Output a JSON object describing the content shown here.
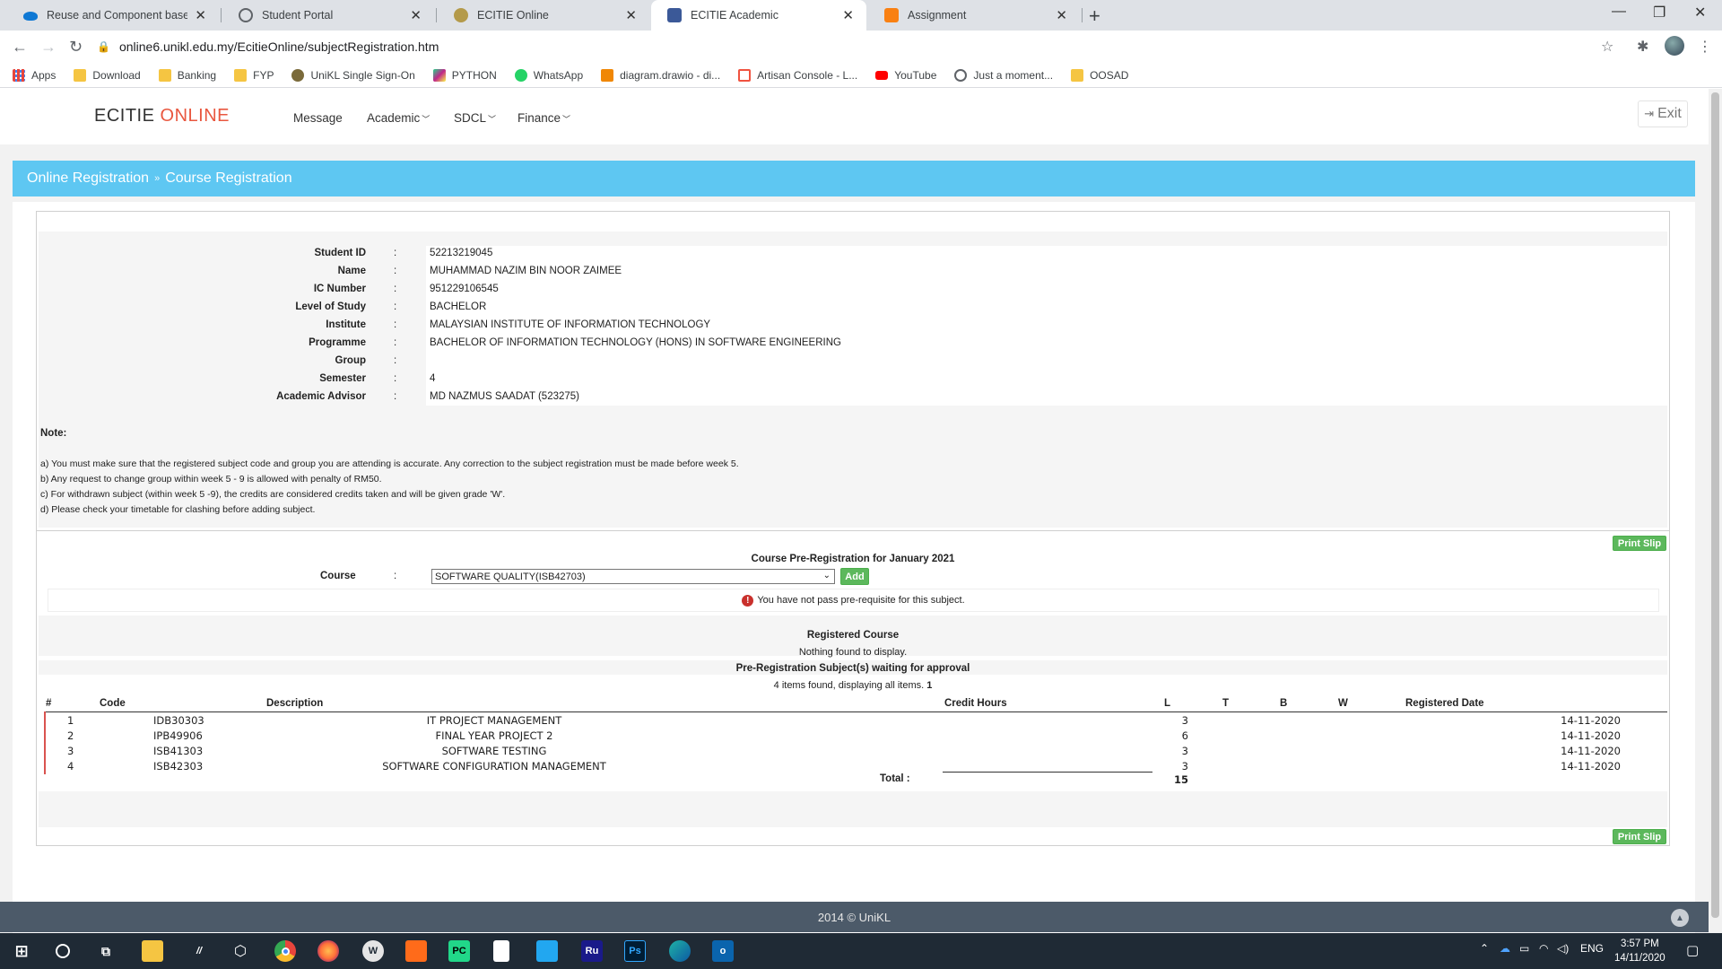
{
  "browser": {
    "tabs": [
      {
        "title": "Reuse and Component based De",
        "icon": "onedrive-icon"
      },
      {
        "title": "Student Portal",
        "icon": "globe-icon"
      },
      {
        "title": "ECITIE Online",
        "icon": "unikl-icon"
      },
      {
        "title": "ECITIE Academic",
        "icon": "ecitie-icon",
        "active": true
      },
      {
        "title": "Assignment",
        "icon": "moodle-icon"
      }
    ],
    "new_tab": "+",
    "url": "online6.unikl.edu.my/EcitieOnline/subjectRegistration.htm",
    "bookmarks": [
      {
        "label": "Apps",
        "icon": "apps-grid-icon",
        "color": "#e8453c"
      },
      {
        "label": "Download",
        "icon": "folder-icon",
        "color": "#f5c542"
      },
      {
        "label": "Banking",
        "icon": "folder-icon",
        "color": "#f5c542"
      },
      {
        "label": "FYP",
        "icon": "folder-icon",
        "color": "#f5c542"
      },
      {
        "label": "UniKL Single Sign-On",
        "icon": "unikl-icon",
        "color": "#7a6a3a"
      },
      {
        "label": "PYTHON",
        "icon": "pycharm-icon",
        "color": "#c0268a"
      },
      {
        "label": "WhatsApp",
        "icon": "whatsapp-icon",
        "color": "#25d366"
      },
      {
        "label": "diagram.drawio - di...",
        "icon": "drawio-icon",
        "color": "#f08705"
      },
      {
        "label": "Artisan Console - L...",
        "icon": "laravel-icon",
        "color": "#f05340"
      },
      {
        "label": "YouTube",
        "icon": "youtube-icon",
        "color": "#ff0000"
      },
      {
        "label": "Just a moment...",
        "icon": "globe-icon",
        "color": "#5f6368"
      },
      {
        "label": "OOSAD",
        "icon": "folder-icon",
        "color": "#f5c542"
      }
    ]
  },
  "nav": {
    "brand_main": "ECITIE",
    "brand_accent": "ONLINE",
    "menu": [
      "Message",
      "Academic",
      "SDCL",
      "Finance"
    ],
    "exit_label": "Exit"
  },
  "breadcrumb": {
    "first": "Online Registration",
    "separator": "»",
    "second": "Course Registration"
  },
  "student": [
    {
      "label": "Student ID",
      "value": "52213219045"
    },
    {
      "label": "Name",
      "value": "MUHAMMAD NAZIM BIN NOOR ZAIMEE"
    },
    {
      "label": "IC Number",
      "value": "951229106545"
    },
    {
      "label": "Level of Study",
      "value": "BACHELOR"
    },
    {
      "label": "Institute",
      "value": "MALAYSIAN INSTITUTE OF INFORMATION TECHNOLOGY"
    },
    {
      "label": "Programme",
      "value": "BACHELOR OF INFORMATION TECHNOLOGY (HONS) IN SOFTWARE ENGINEERING"
    },
    {
      "label": "Group",
      "value": ""
    },
    {
      "label": "Semester",
      "value": "4"
    },
    {
      "label": "Academic Advisor",
      "value": "MD NAZMUS SAADAT (523275)"
    }
  ],
  "colon": ":",
  "note": {
    "title": "Note:",
    "lines": [
      "a) You must make sure that the registered subject code and group you are attending is accurate. Any correction to the subject registration must be made before week 5.",
      "b) Any request to change group within week 5 - 9 is allowed with penalty of RM50.",
      "c) For withdrawn subject (within week 5 -9), the credits are considered credits taken and will be given grade 'W'.",
      "d) Please check your timetable for clashing before adding subject."
    ]
  },
  "print_slip_label": "Print Slip",
  "prereg": {
    "title": "Course Pre-Registration for January 2021",
    "course_label": "Course",
    "selected_course": "SOFTWARE QUALITY(ISB42703)",
    "add_label": "Add",
    "error_message": "You have not pass pre-requisite for this subject."
  },
  "registered": {
    "title": "Registered Course",
    "empty_text": "Nothing found to display."
  },
  "pending": {
    "title": "Pre-Registration Subject(s) waiting for approval",
    "count_text": "4 items found, displaying all items.",
    "page_number": "1",
    "headers": [
      "#",
      "Code",
      "Description",
      "Credit Hours",
      "L",
      "T",
      "B",
      "W",
      "Registered Date"
    ],
    "rows": [
      {
        "no": "1",
        "code": "IDB30303",
        "description": "IT PROJECT MANAGEMENT",
        "credit": "3",
        "date": "14-11-2020"
      },
      {
        "no": "2",
        "code": "IPB49906",
        "description": "FINAL YEAR PROJECT 2",
        "credit": "6",
        "date": "14-11-2020"
      },
      {
        "no": "3",
        "code": "ISB41303",
        "description": "SOFTWARE TESTING",
        "credit": "3",
        "date": "14-11-2020"
      },
      {
        "no": "4",
        "code": "ISB42303",
        "description": "SOFTWARE CONFIGURATION MANAGEMENT",
        "credit": "3",
        "date": "14-11-2020"
      }
    ],
    "total_label": "Total :",
    "total_value": "15"
  },
  "footer": {
    "text": "2014 © UniKL"
  },
  "taskbar": {
    "lang": "ENG",
    "time": "3:57 PM",
    "date": "14/11/2020",
    "apps": [
      {
        "icon": "windows-start-icon",
        "color": "#1f2a35"
      },
      {
        "icon": "search-circle-icon",
        "color": "#1f2a35"
      },
      {
        "icon": "task-view-icon",
        "color": "#1f2a35"
      },
      {
        "icon": "file-explorer-icon",
        "color": "#f5c542"
      },
      {
        "icon": "app-aa-icon",
        "color": "#1f2a35"
      },
      {
        "icon": "app-hex-icon",
        "color": "#1f2a35"
      },
      {
        "icon": "chrome-icon",
        "color": "#e8453c"
      },
      {
        "icon": "firefox-icon",
        "color": "#ff7139"
      },
      {
        "icon": "app-w-icon",
        "color": "#e5e5e5"
      },
      {
        "icon": "app-orange-icon",
        "color": "#ff6b1a"
      },
      {
        "icon": "pycharm-icon",
        "color": "#21d789"
      },
      {
        "icon": "notepad-icon",
        "color": "#ffffff"
      },
      {
        "icon": "vscode-icon",
        "color": "#22a7f0"
      },
      {
        "icon": "rubymine-icon",
        "color": "#1a1a8a"
      },
      {
        "icon": "photoshop-icon",
        "color": "#001d34"
      },
      {
        "icon": "edge-icon",
        "color": "#1fb3a5"
      },
      {
        "icon": "outlook-icon",
        "color": "#0a64ad"
      }
    ],
    "app_glyphs": [
      "",
      "",
      "",
      "",
      "",
      "",
      "",
      "",
      "W",
      "",
      "PC",
      "",
      "",
      "Ru",
      "Ps",
      "",
      "o"
    ]
  }
}
